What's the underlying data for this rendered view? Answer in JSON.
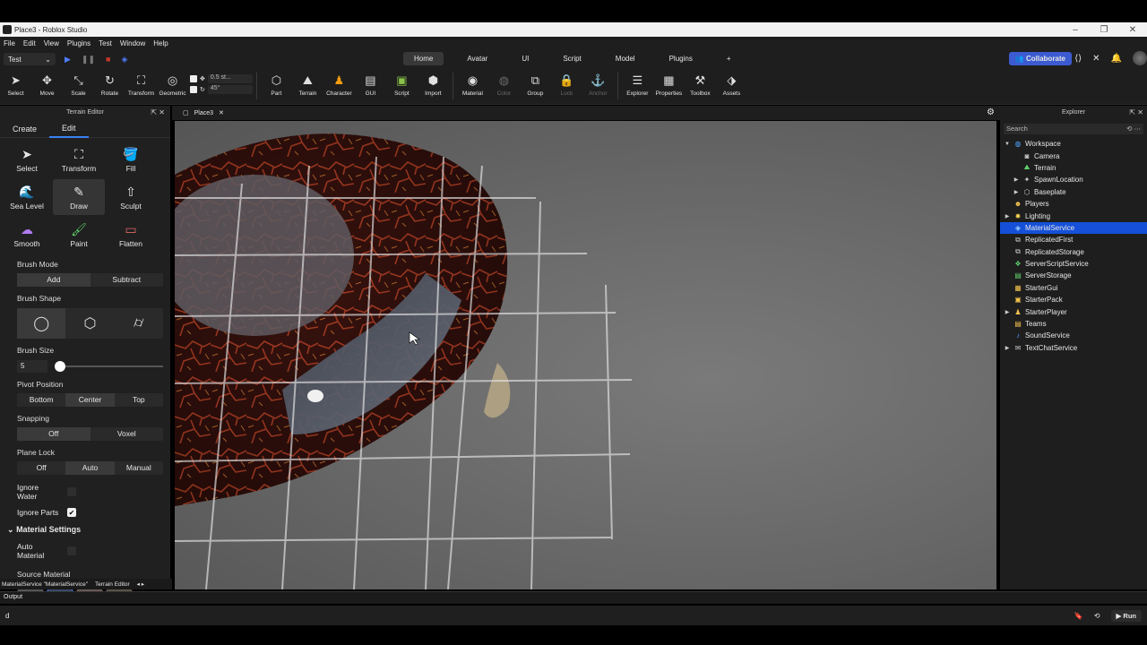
{
  "window": {
    "title": "Place3 - Roblox Studio"
  },
  "menu": [
    "File",
    "Edit",
    "View",
    "Plugins",
    "Test",
    "Window",
    "Help"
  ],
  "header": {
    "mode_select": "Test",
    "ribbon_tabs": [
      "Home",
      "Avatar",
      "UI",
      "Script",
      "Model",
      "Plugins",
      "+"
    ],
    "active_tab": "Home",
    "collaborate_label": "Collaborate"
  },
  "toolbar": {
    "tools": [
      {
        "label": "Select",
        "icon": "cursor-icon"
      },
      {
        "label": "Move",
        "icon": "move-icon"
      },
      {
        "label": "Scale",
        "icon": "scale-icon"
      },
      {
        "label": "Rotate",
        "icon": "rotate-icon"
      },
      {
        "label": "Transform",
        "icon": "transform-icon"
      },
      {
        "label": "Geometric",
        "icon": "geometric-icon"
      }
    ],
    "geo_move": "0.5 st...",
    "geo_rotate": "45°",
    "insert_tools": [
      {
        "label": "Part",
        "icon": "part-icon",
        "disabled": false
      },
      {
        "label": "Terrain",
        "icon": "terrain-icon",
        "disabled": false
      },
      {
        "label": "Character",
        "icon": "character-icon",
        "disabled": false
      },
      {
        "label": "GUI",
        "icon": "gui-icon",
        "disabled": false
      },
      {
        "label": "Script",
        "icon": "script-icon",
        "disabled": false
      },
      {
        "label": "Import",
        "icon": "import-icon",
        "disabled": false
      }
    ],
    "edit_tools": [
      {
        "label": "Material",
        "icon": "material-icon",
        "disabled": false
      },
      {
        "label": "Color",
        "icon": "color-icon",
        "disabled": true
      },
      {
        "label": "Group",
        "icon": "group-icon",
        "disabled": false
      },
      {
        "label": "Lock",
        "icon": "lock-icon",
        "disabled": true
      },
      {
        "label": "Anchor",
        "icon": "anchor-icon",
        "disabled": true
      }
    ],
    "panel_tools": [
      {
        "label": "Explorer",
        "icon": "explorer-icon",
        "disabled": false
      },
      {
        "label": "Properties",
        "icon": "properties-icon",
        "disabled": false
      },
      {
        "label": "Toolbox",
        "icon": "toolbox-icon",
        "disabled": false
      },
      {
        "label": "Assets",
        "icon": "assets-icon",
        "disabled": false
      }
    ]
  },
  "terrain_editor": {
    "title": "Terrain Editor",
    "tabs": [
      "Create",
      "Edit"
    ],
    "active_tab": "Edit",
    "tools": [
      {
        "label": "Select",
        "icon": "cursor-icon"
      },
      {
        "label": "Transform",
        "icon": "transform-icon"
      },
      {
        "label": "Fill",
        "icon": "fill-icon"
      },
      {
        "label": "Sea Level",
        "icon": "sea-level-icon"
      },
      {
        "label": "Draw",
        "icon": "draw-icon"
      },
      {
        "label": "Sculpt",
        "icon": "sculpt-icon"
      },
      {
        "label": "Smooth",
        "icon": "smooth-icon"
      },
      {
        "label": "Paint",
        "icon": "paint-icon"
      },
      {
        "label": "Flatten",
        "icon": "flatten-icon"
      }
    ],
    "active_tool": "Draw",
    "brush_mode": {
      "label": "Brush Mode",
      "options": [
        "Add",
        "Subtract"
      ],
      "selected": "Add"
    },
    "brush_shape": {
      "label": "Brush Shape",
      "options": [
        "sphere",
        "cube",
        "cylinder"
      ],
      "selected": "sphere"
    },
    "brush_size": {
      "label": "Brush Size",
      "value": "5"
    },
    "pivot_position": {
      "label": "Pivot Position",
      "options": [
        "Bottom",
        "Center",
        "Top"
      ],
      "selected": "Center"
    },
    "snapping": {
      "label": "Snapping",
      "options": [
        "Off",
        "Voxel"
      ],
      "selected": "Off"
    },
    "plane_lock": {
      "label": "Plane Lock",
      "options": [
        "Off",
        "Auto",
        "Manual"
      ],
      "selected": "Auto"
    },
    "ignore_water": {
      "label": "Ignore Water",
      "checked": false
    },
    "ignore_parts": {
      "label": "Ignore Parts",
      "checked": true
    },
    "material_settings": "Material Settings",
    "auto_material": {
      "label": "Auto Material",
      "checked": false
    },
    "source_material": "Source Material"
  },
  "bottom_tabs": [
    "MaterialService \"MaterialService\"",
    "Terrain Editor"
  ],
  "output_label": "Output",
  "command_input": "d",
  "run_label": "Run",
  "document_tab": "Place3",
  "explorer": {
    "title": "Explorer",
    "search_placeholder": "Search",
    "items": [
      {
        "label": "Workspace",
        "depth": 0,
        "expanded": true,
        "icon": "workspace-icon",
        "color": "#4fa3ff"
      },
      {
        "label": "Camera",
        "depth": 1,
        "icon": "camera-icon",
        "color": "#cccccc"
      },
      {
        "label": "Terrain",
        "depth": 1,
        "icon": "terrain-icon",
        "color": "#5fcf6a"
      },
      {
        "label": "SpawnLocation",
        "depth": 1,
        "collapsed": true,
        "icon": "spawn-icon",
        "color": "#cccccc"
      },
      {
        "label": "Baseplate",
        "depth": 1,
        "collapsed": true,
        "icon": "part-icon",
        "color": "#cccccc"
      },
      {
        "label": "Players",
        "depth": 0,
        "icon": "players-icon",
        "color": "#f2c14e"
      },
      {
        "label": "Lighting",
        "depth": 0,
        "collapsed": true,
        "icon": "lighting-icon",
        "color": "#f2d14e"
      },
      {
        "label": "MaterialService",
        "depth": 0,
        "selected": true,
        "icon": "material-service-icon",
        "color": "#9fd3ff"
      },
      {
        "label": "ReplicatedFirst",
        "depth": 0,
        "icon": "replicated-first-icon",
        "color": "#cccccc"
      },
      {
        "label": "ReplicatedStorage",
        "depth": 0,
        "icon": "replicated-storage-icon",
        "color": "#cccccc"
      },
      {
        "label": "ServerScriptService",
        "depth": 0,
        "icon": "server-script-icon",
        "color": "#5fcf6a"
      },
      {
        "label": "ServerStorage",
        "depth": 0,
        "icon": "server-storage-icon",
        "color": "#5fcf6a"
      },
      {
        "label": "StarterGui",
        "depth": 0,
        "icon": "starter-gui-icon",
        "color": "#f2c14e"
      },
      {
        "label": "StarterPack",
        "depth": 0,
        "icon": "starter-pack-icon",
        "color": "#f2c14e"
      },
      {
        "label": "StarterPlayer",
        "depth": 0,
        "collapsed": true,
        "icon": "starter-player-icon",
        "color": "#f2c14e"
      },
      {
        "label": "Teams",
        "depth": 0,
        "icon": "teams-icon",
        "color": "#f2c14e"
      },
      {
        "label": "SoundService",
        "depth": 0,
        "icon": "sound-icon",
        "color": "#4fa3ff"
      },
      {
        "label": "TextChatService",
        "depth": 0,
        "collapsed": true,
        "icon": "text-chat-icon",
        "color": "#cccccc"
      }
    ]
  },
  "colors": {
    "accent": "#3b82f6",
    "selection": "#1650d8",
    "collaborate": "#3c5bd1",
    "lava": "#c0392b"
  }
}
